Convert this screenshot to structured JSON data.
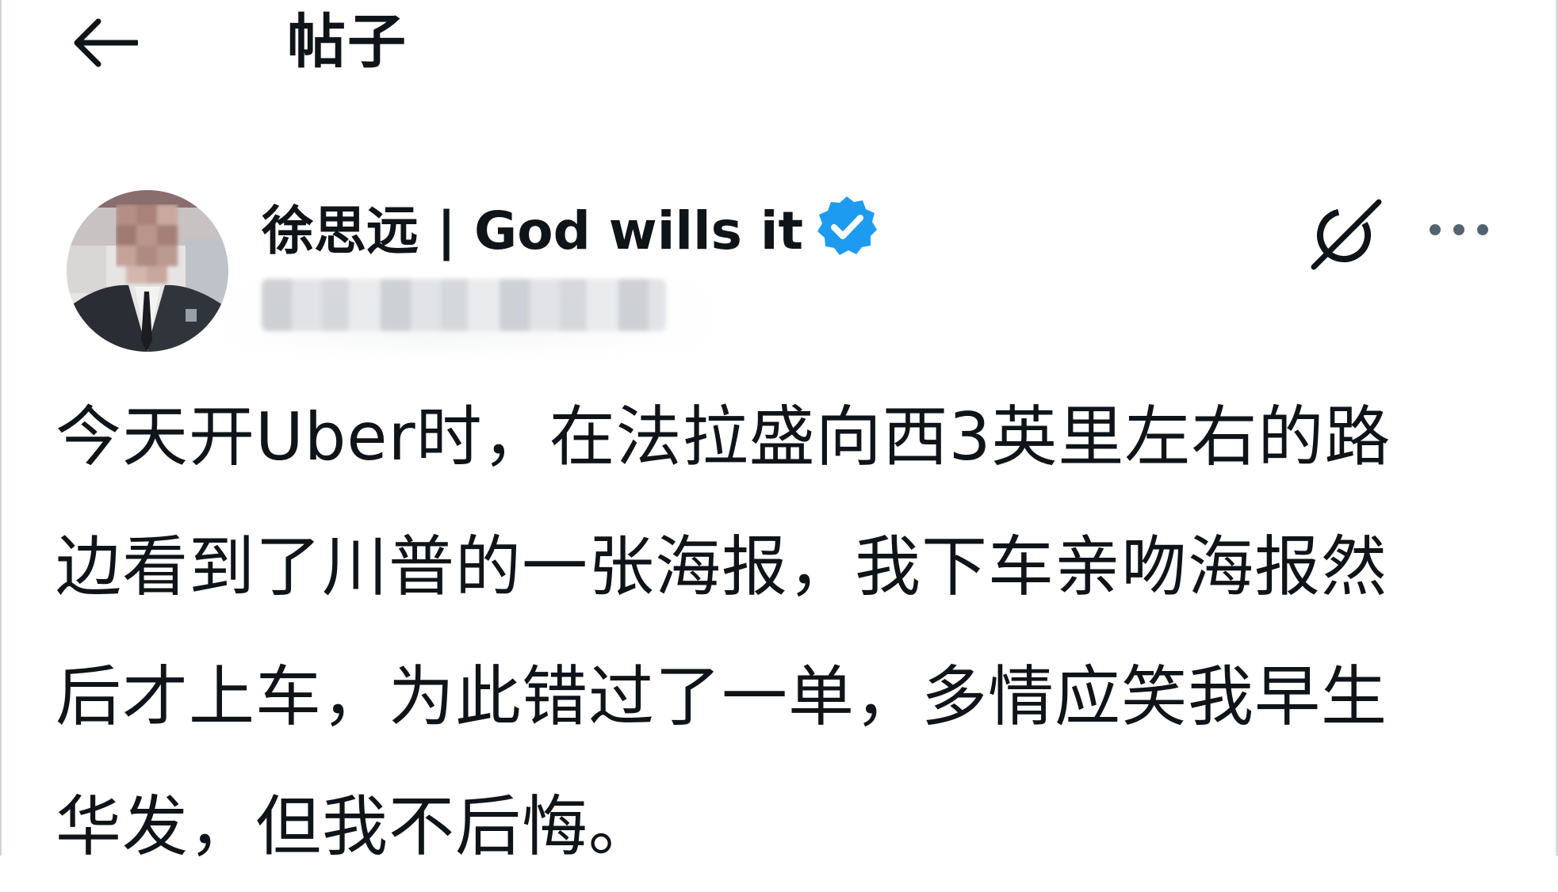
{
  "header": {
    "title": "帖子",
    "back_icon": "arrow-left-icon"
  },
  "author": {
    "display_name": "徐思远 | God wills it",
    "verified_icon": "verified-badge-icon",
    "verified_color": "#1d9bf0",
    "handle": "",
    "avatar_icon": "avatar-blurred"
  },
  "actions": {
    "grok_icon": "grok-icon",
    "more_icon": "more-horizontal-icon"
  },
  "post": {
    "lines": [
      "今天开Uber时，在法拉盛向西3英里左右的路",
      "边看到了川普的一张海报，我下车亲吻海报然",
      "后才上车，为此错过了一单，多情应笑我早生",
      "华发，但我不后悔。"
    ]
  },
  "colors": {
    "text": "#0f1419",
    "background": "#ffffff"
  }
}
